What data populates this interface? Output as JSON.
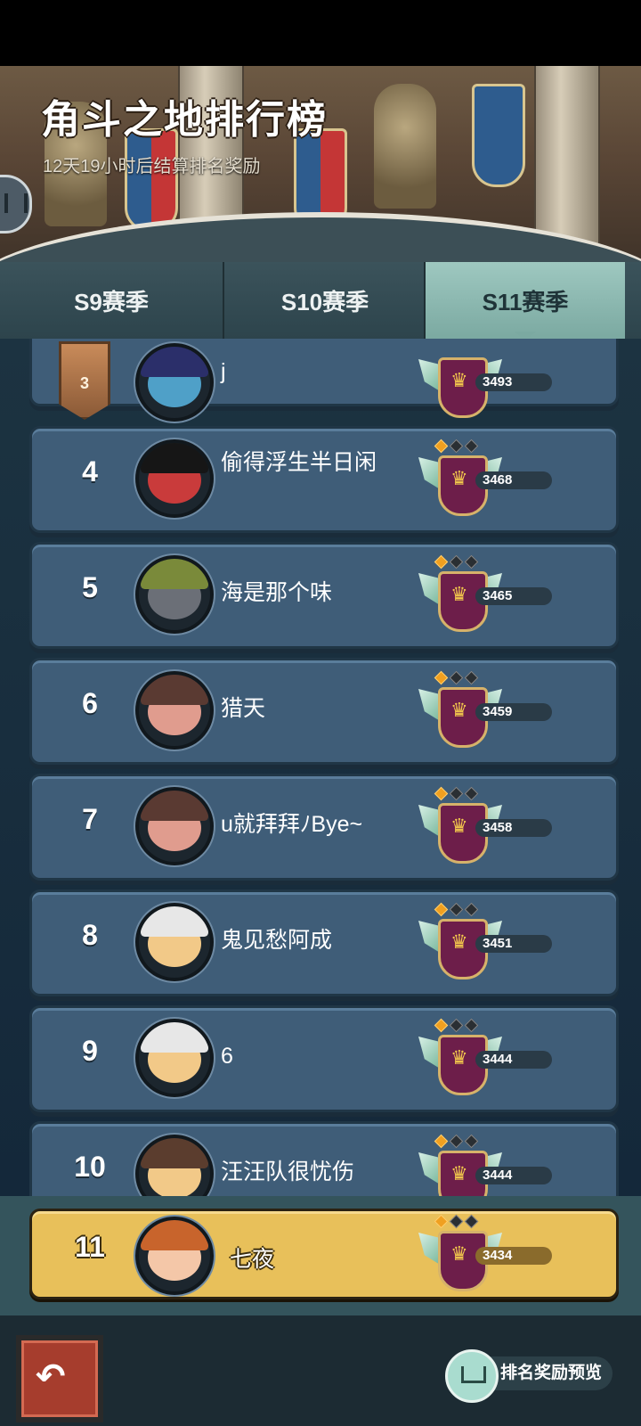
{
  "header": {
    "title": "角斗之地排行榜",
    "subtitle": "12天19小时后结算排名奖励"
  },
  "tabs": [
    {
      "label": "S9赛季",
      "active": false
    },
    {
      "label": "S10赛季",
      "active": false
    },
    {
      "label": "S11赛季",
      "active": true
    }
  ],
  "leaderboard": [
    {
      "rank": "3",
      "name": "j",
      "score": "3493"
    },
    {
      "rank": "4",
      "name": "偷得浮生半日闲",
      "score": "3468"
    },
    {
      "rank": "5",
      "name": "海是那个味",
      "score": "3465"
    },
    {
      "rank": "6",
      "name": "猎天",
      "score": "3459"
    },
    {
      "rank": "7",
      "name": "u就拜拜ﾉBye~",
      "score": "3458"
    },
    {
      "rank": "8",
      "name": "鬼见愁阿成",
      "score": "3451"
    },
    {
      "rank": "9",
      "name": "6",
      "score": "3444"
    },
    {
      "rank": "10",
      "name": "汪汪队很忧伤",
      "score": "3444"
    }
  ],
  "my_entry": {
    "rank": "11",
    "name": "七夜",
    "score": "3434"
  },
  "footer": {
    "back_icon": "back-arrow-icon",
    "reward_preview_label": "排名奖励预览"
  },
  "colors": {
    "row_bg": "#3f5d78",
    "my_row_bg": "#e8c05a",
    "active_tab": "#7ba9a1"
  }
}
